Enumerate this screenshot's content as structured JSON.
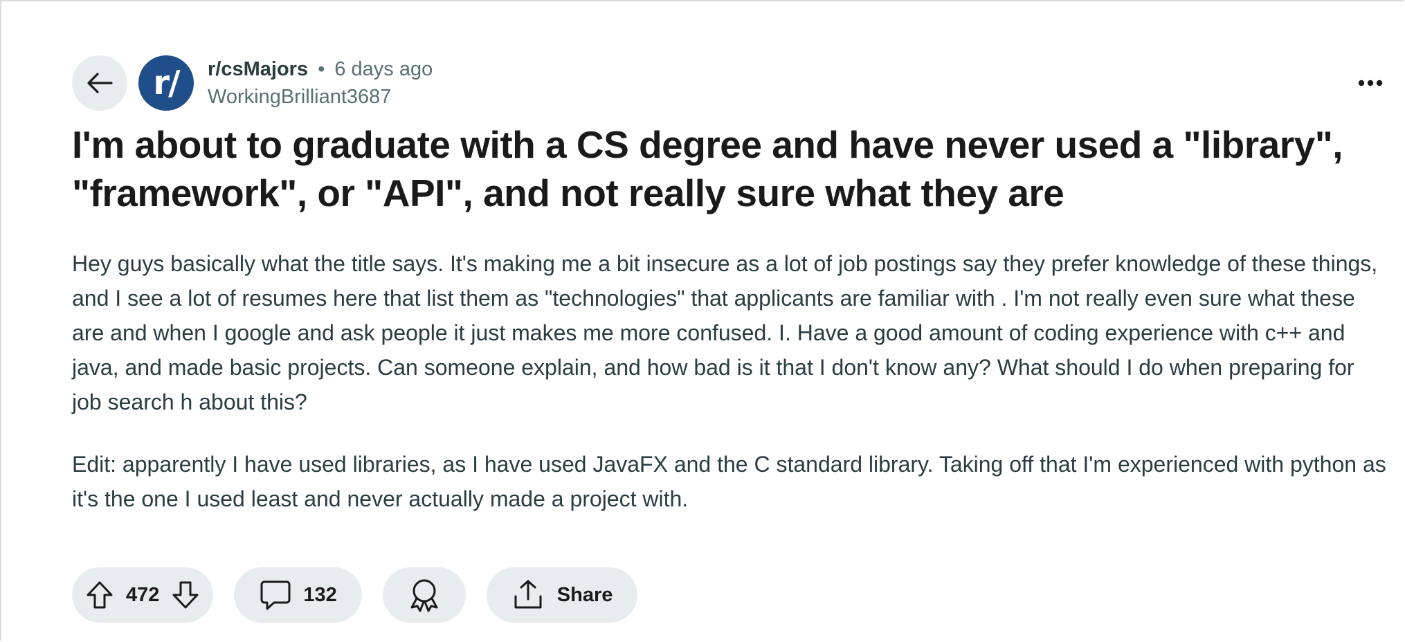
{
  "post": {
    "subreddit": "r/csMajors",
    "separator": "•",
    "age": "6 days ago",
    "author": "WorkingBrilliant3687",
    "avatar_text": "r/",
    "title": "I'm about to graduate with a CS degree and have never used a \"library\", \"framework\", or \"API\", and not really sure what they are",
    "body_paragraphs": [
      "Hey guys basically what the title says. It's making me a bit insecure as a lot of job postings say they prefer knowledge of these things, and I see a lot of resumes here that list them as \"technologies\" that applicants are familiar with . I'm not really even sure what these are and when I google and ask people it just makes me more confused. I. Have a good amount of coding experience with c++ and java, and made basic projects. Can someone explain, and how bad is it that I don't know any? What should I do when preparing for job search h about this?",
      "Edit: apparently I have used libraries, as I have used JavaFX and the C standard library. Taking off that I'm experienced with python as it's the one I used least and never actually made a project with."
    ]
  },
  "actions": {
    "votes": "472",
    "comments": "132",
    "share_label": "Share"
  },
  "icons": {
    "back": "back-arrow-icon",
    "more": "more-options-icon",
    "upvote": "upvote-icon",
    "downvote": "downvote-icon",
    "comment": "comment-icon",
    "award": "award-icon",
    "share": "share-icon"
  },
  "colors": {
    "pill_bg": "#e7ecef",
    "avatar_bg": "#1f4e8b",
    "meta_text": "#576f76"
  }
}
